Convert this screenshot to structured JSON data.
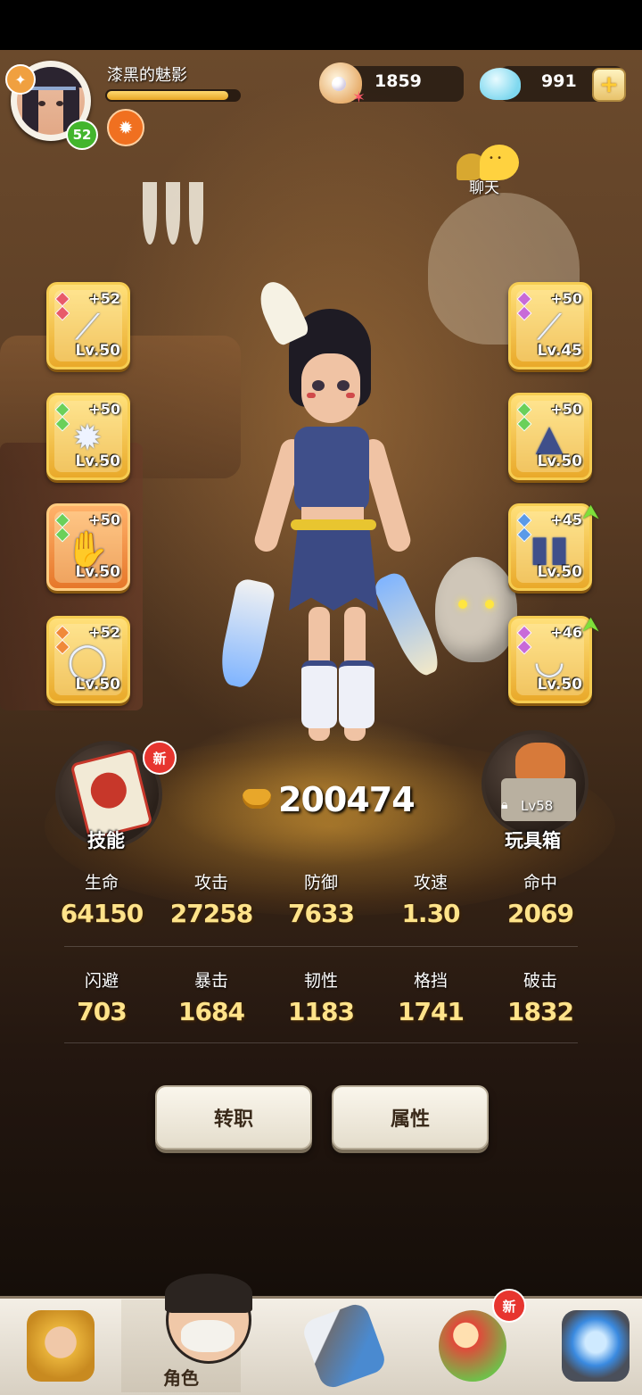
{
  "player": {
    "name": "漆黑的魅影",
    "level": "52",
    "exp_progress": 0.92
  },
  "currency": {
    "shells": "1859",
    "gems": "991",
    "add_icon": "plus-icon"
  },
  "chat": {
    "label": "聊天"
  },
  "equipment": {
    "left": [
      {
        "icon": "bone-spear-icon",
        "plus": "+52",
        "level": "Lv.50",
        "gems": [
          "#e85a6a",
          "#e85a6a"
        ],
        "frame": "gold"
      },
      {
        "icon": "spiked-armor-icon",
        "plus": "+50",
        "level": "Lv.50",
        "gems": [
          "#6ad05a",
          "#6ad05a"
        ],
        "frame": "gold"
      },
      {
        "icon": "claw-gauntlet-icon",
        "plus": "+50",
        "level": "Lv.50",
        "gems": [
          "#6ad05a",
          "#6ad05a"
        ],
        "frame": "orange"
      },
      {
        "icon": "ring-icon",
        "plus": "+52",
        "level": "Lv.50",
        "gems": [
          "#f08a3a",
          "#f08a3a"
        ],
        "frame": "gold"
      }
    ],
    "right": [
      {
        "icon": "dagger-icon",
        "plus": "+50",
        "level": "Lv.45",
        "gems": [
          "#c86ad8",
          "#c86ad8"
        ],
        "frame": "gold",
        "upgradable": false
      },
      {
        "icon": "hood-icon",
        "plus": "+50",
        "level": "Lv.50",
        "gems": [
          "#6ad05a",
          "#6ad05a"
        ],
        "frame": "gold",
        "upgradable": false
      },
      {
        "icon": "leg-guard-icon",
        "plus": "+45",
        "level": "Lv.50",
        "gems": [
          "#5a9ae8",
          "#5a9ae8"
        ],
        "frame": "gold",
        "upgradable": true
      },
      {
        "icon": "necklace-icon",
        "plus": "+46",
        "level": "Lv.50",
        "gems": [
          "#c86ad8",
          "#c86ad8"
        ],
        "frame": "gold",
        "upgradable": true
      }
    ]
  },
  "skill": {
    "label": "技能",
    "badge": "新"
  },
  "toybox": {
    "label": "玩具箱",
    "level": "Lv58",
    "locked": true
  },
  "power": {
    "value": "200474"
  },
  "stats": {
    "row1": [
      {
        "name": "生命",
        "value": "64150"
      },
      {
        "name": "攻击",
        "value": "27258"
      },
      {
        "name": "防御",
        "value": "7633"
      },
      {
        "name": "攻速",
        "value": "1.30"
      },
      {
        "name": "命中",
        "value": "2069"
      }
    ],
    "row2": [
      {
        "name": "闪避",
        "value": "703"
      },
      {
        "name": "暴击",
        "value": "1684"
      },
      {
        "name": "韧性",
        "value": "1183"
      },
      {
        "name": "格挡",
        "value": "1741"
      },
      {
        "name": "破击",
        "value": "1832"
      }
    ]
  },
  "actions": {
    "transfer": "转职",
    "attributes": "属性"
  },
  "nav": {
    "active": "角色",
    "tabs": [
      {
        "icon": "caveman-icon",
        "label": ""
      },
      {
        "icon": "character-icon",
        "label": "角色"
      },
      {
        "icon": "weapon-icon",
        "label": ""
      },
      {
        "icon": "pet-icon",
        "label": "",
        "badge": "新"
      },
      {
        "icon": "portal-icon",
        "label": ""
      }
    ]
  },
  "colors": {
    "accent_gold": "#ffe38a",
    "new_badge": "#e7352f",
    "level_badge": "#43b52d"
  }
}
